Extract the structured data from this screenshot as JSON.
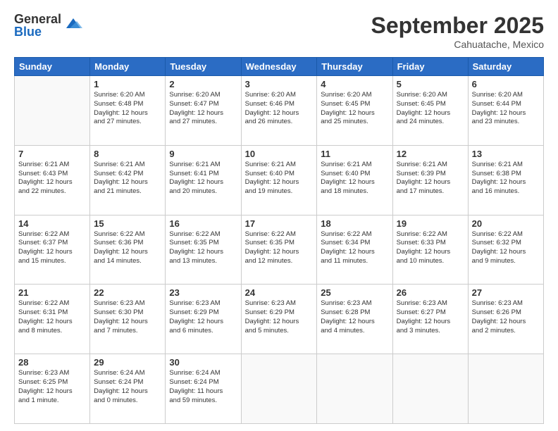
{
  "logo": {
    "general": "General",
    "blue": "Blue"
  },
  "header": {
    "month": "September 2025",
    "location": "Cahuatache, Mexico"
  },
  "weekdays": [
    "Sunday",
    "Monday",
    "Tuesday",
    "Wednesday",
    "Thursday",
    "Friday",
    "Saturday"
  ],
  "weeks": [
    [
      {
        "day": "",
        "info": ""
      },
      {
        "day": "1",
        "info": "Sunrise: 6:20 AM\nSunset: 6:48 PM\nDaylight: 12 hours\nand 27 minutes."
      },
      {
        "day": "2",
        "info": "Sunrise: 6:20 AM\nSunset: 6:47 PM\nDaylight: 12 hours\nand 27 minutes."
      },
      {
        "day": "3",
        "info": "Sunrise: 6:20 AM\nSunset: 6:46 PM\nDaylight: 12 hours\nand 26 minutes."
      },
      {
        "day": "4",
        "info": "Sunrise: 6:20 AM\nSunset: 6:45 PM\nDaylight: 12 hours\nand 25 minutes."
      },
      {
        "day": "5",
        "info": "Sunrise: 6:20 AM\nSunset: 6:45 PM\nDaylight: 12 hours\nand 24 minutes."
      },
      {
        "day": "6",
        "info": "Sunrise: 6:20 AM\nSunset: 6:44 PM\nDaylight: 12 hours\nand 23 minutes."
      }
    ],
    [
      {
        "day": "7",
        "info": "Sunrise: 6:21 AM\nSunset: 6:43 PM\nDaylight: 12 hours\nand 22 minutes."
      },
      {
        "day": "8",
        "info": "Sunrise: 6:21 AM\nSunset: 6:42 PM\nDaylight: 12 hours\nand 21 minutes."
      },
      {
        "day": "9",
        "info": "Sunrise: 6:21 AM\nSunset: 6:41 PM\nDaylight: 12 hours\nand 20 minutes."
      },
      {
        "day": "10",
        "info": "Sunrise: 6:21 AM\nSunset: 6:40 PM\nDaylight: 12 hours\nand 19 minutes."
      },
      {
        "day": "11",
        "info": "Sunrise: 6:21 AM\nSunset: 6:40 PM\nDaylight: 12 hours\nand 18 minutes."
      },
      {
        "day": "12",
        "info": "Sunrise: 6:21 AM\nSunset: 6:39 PM\nDaylight: 12 hours\nand 17 minutes."
      },
      {
        "day": "13",
        "info": "Sunrise: 6:21 AM\nSunset: 6:38 PM\nDaylight: 12 hours\nand 16 minutes."
      }
    ],
    [
      {
        "day": "14",
        "info": "Sunrise: 6:22 AM\nSunset: 6:37 PM\nDaylight: 12 hours\nand 15 minutes."
      },
      {
        "day": "15",
        "info": "Sunrise: 6:22 AM\nSunset: 6:36 PM\nDaylight: 12 hours\nand 14 minutes."
      },
      {
        "day": "16",
        "info": "Sunrise: 6:22 AM\nSunset: 6:35 PM\nDaylight: 12 hours\nand 13 minutes."
      },
      {
        "day": "17",
        "info": "Sunrise: 6:22 AM\nSunset: 6:35 PM\nDaylight: 12 hours\nand 12 minutes."
      },
      {
        "day": "18",
        "info": "Sunrise: 6:22 AM\nSunset: 6:34 PM\nDaylight: 12 hours\nand 11 minutes."
      },
      {
        "day": "19",
        "info": "Sunrise: 6:22 AM\nSunset: 6:33 PM\nDaylight: 12 hours\nand 10 minutes."
      },
      {
        "day": "20",
        "info": "Sunrise: 6:22 AM\nSunset: 6:32 PM\nDaylight: 12 hours\nand 9 minutes."
      }
    ],
    [
      {
        "day": "21",
        "info": "Sunrise: 6:22 AM\nSunset: 6:31 PM\nDaylight: 12 hours\nand 8 minutes."
      },
      {
        "day": "22",
        "info": "Sunrise: 6:23 AM\nSunset: 6:30 PM\nDaylight: 12 hours\nand 7 minutes."
      },
      {
        "day": "23",
        "info": "Sunrise: 6:23 AM\nSunset: 6:29 PM\nDaylight: 12 hours\nand 6 minutes."
      },
      {
        "day": "24",
        "info": "Sunrise: 6:23 AM\nSunset: 6:29 PM\nDaylight: 12 hours\nand 5 minutes."
      },
      {
        "day": "25",
        "info": "Sunrise: 6:23 AM\nSunset: 6:28 PM\nDaylight: 12 hours\nand 4 minutes."
      },
      {
        "day": "26",
        "info": "Sunrise: 6:23 AM\nSunset: 6:27 PM\nDaylight: 12 hours\nand 3 minutes."
      },
      {
        "day": "27",
        "info": "Sunrise: 6:23 AM\nSunset: 6:26 PM\nDaylight: 12 hours\nand 2 minutes."
      }
    ],
    [
      {
        "day": "28",
        "info": "Sunrise: 6:23 AM\nSunset: 6:25 PM\nDaylight: 12 hours\nand 1 minute."
      },
      {
        "day": "29",
        "info": "Sunrise: 6:24 AM\nSunset: 6:24 PM\nDaylight: 12 hours\nand 0 minutes."
      },
      {
        "day": "30",
        "info": "Sunrise: 6:24 AM\nSunset: 6:24 PM\nDaylight: 11 hours\nand 59 minutes."
      },
      {
        "day": "",
        "info": ""
      },
      {
        "day": "",
        "info": ""
      },
      {
        "day": "",
        "info": ""
      },
      {
        "day": "",
        "info": ""
      }
    ]
  ]
}
